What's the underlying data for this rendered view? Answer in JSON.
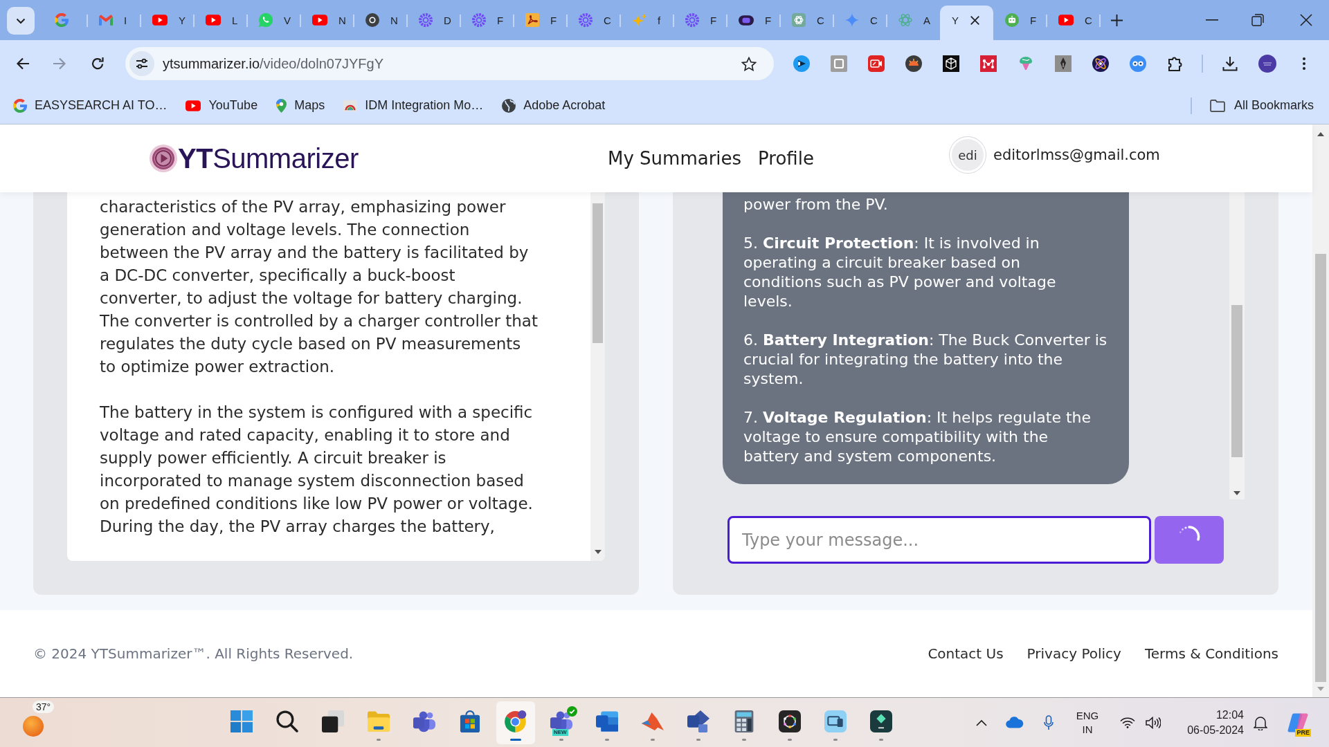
{
  "browser": {
    "tabs": [
      {
        "kind": "google",
        "pinned": true,
        "selected": false
      },
      {
        "kind": "mail",
        "title": "I",
        "pinned": false,
        "selected": false
      },
      {
        "kind": "video",
        "title": "Y",
        "pinned": false,
        "selected": false
      },
      {
        "kind": "video",
        "title": "L",
        "pinned": false,
        "selected": false
      },
      {
        "kind": "chat",
        "title": "V",
        "pinned": false,
        "selected": false
      },
      {
        "kind": "video",
        "title": "N",
        "pinned": false,
        "selected": false
      },
      {
        "kind": "ring",
        "title": "N",
        "pinned": false,
        "selected": false
      },
      {
        "kind": "gear",
        "title": "D",
        "pinned": false,
        "selected": false
      },
      {
        "kind": "gear",
        "title": "F",
        "pinned": false,
        "selected": false
      },
      {
        "kind": "pdf",
        "title": "F",
        "pinned": false,
        "selected": false
      },
      {
        "kind": "gear",
        "title": "C",
        "pinned": false,
        "selected": false
      },
      {
        "kind": "sparkle",
        "title": "f",
        "pinned": false,
        "selected": false
      },
      {
        "kind": "gear",
        "title": "F",
        "pinned": false,
        "selected": false
      },
      {
        "kind": "mask",
        "title": "F",
        "pinned": false,
        "selected": false
      },
      {
        "kind": "knot",
        "title": "C",
        "pinned": false,
        "selected": false
      },
      {
        "kind": "star",
        "title": "C",
        "pinned": false,
        "selected": false
      },
      {
        "kind": "mesh",
        "title": "A",
        "pinned": false,
        "selected": false
      },
      {
        "kind": "none",
        "title": "Y",
        "pinned": false,
        "selected": true
      },
      {
        "kind": "robot",
        "title": "F",
        "pinned": false,
        "selected": false
      },
      {
        "kind": "video",
        "title": "C",
        "pinned": false,
        "selected": false
      }
    ],
    "address": {
      "host": "ytsummarizer.io",
      "path": "/video/doln07JYFgY"
    },
    "bookmarks": [
      {
        "kind": "google",
        "label": "EASYSEARCH AI TO…"
      },
      {
        "kind": "video",
        "label": "YouTube"
      },
      {
        "kind": "pin",
        "label": "Maps"
      },
      {
        "kind": "arc",
        "label": "IDM Integration Mo…"
      },
      {
        "kind": "globe",
        "label": "Adobe Acrobat"
      }
    ],
    "all_bookmarks": "All Bookmarks"
  },
  "page": {
    "logo": "**YT**Summarizer",
    "nav": [
      "My Summaries",
      "Profile"
    ],
    "user": {
      "initials": "edi",
      "email": "editorlmss@gmail.com"
    },
    "summary": {
      "paragraphs": [
        "characteristics of the PV array, emphasizing power\ngeneration and voltage levels. The connection\nbetween the PV array and the battery is facilitated by\na DC-DC converter, specifically a buck-boost\nconverter, to adjust the voltage for battery charging.\nThe converter is controlled by a charger controller that\nregulates the duty cycle based on PV measurements\nto optimize power extraction.",
        "The battery in the system is configured with a specific\nvoltage and rated capacity, enabling it to store and\nsupply power efficiently. A circuit breaker is\nincorporated to manage system disconnection based\non predefined conditions like low PV power or voltage.\nDuring the day, the PV array charges the battery,"
      ]
    },
    "chat": {
      "messages": [
        {
          "kind": "bot",
          "paragraphs": [
            "power from the PV.",
            "5. **Circuit Protection**: It is involved in\noperating a circuit breaker based on\nconditions such as PV power and voltage\nlevels.",
            "6. **Battery Integration**: The Buck Converter is\ncrucial for integrating the battery into the\nsystem.",
            "7. **Voltage Regulation**: It helps regulate the\nvoltage to ensure compatibility with the\nbattery and system components."
          ]
        }
      ],
      "input": {
        "placeholder": "Type your message..."
      },
      "send": {
        "loading": true
      }
    },
    "footer": {
      "copyright": "© 2024 YTSummarizer™. All Rights Reserved.",
      "links": [
        "Contact Us",
        "Privacy Policy",
        "Terms & Conditions"
      ]
    }
  },
  "taskbar": {
    "weather": {
      "temperature": "37°"
    },
    "apps": [
      {
        "kind": "start",
        "open": false,
        "selected": false
      },
      {
        "kind": "search",
        "open": false,
        "selected": false
      },
      {
        "kind": "taskview",
        "open": false,
        "selected": false
      },
      {
        "kind": "folder",
        "open": true,
        "selected": false
      },
      {
        "kind": "teams",
        "open": false,
        "selected": false
      },
      {
        "kind": "store",
        "open": false,
        "selected": false
      },
      {
        "kind": "browser",
        "open": true,
        "selected": true
      },
      {
        "kind": "teams",
        "tag": "NEW",
        "open": true,
        "selected": false
      },
      {
        "kind": "word",
        "open": true,
        "selected": false
      },
      {
        "kind": "matlab",
        "open": true,
        "selected": false
      },
      {
        "kind": "visio",
        "open": true,
        "selected": false
      },
      {
        "kind": "calculator",
        "open": true,
        "selected": false
      },
      {
        "kind": "camera",
        "open": true,
        "selected": false
      },
      {
        "kind": "phone",
        "open": true,
        "selected": false
      },
      {
        "kind": "editor",
        "open": true,
        "selected": false
      }
    ],
    "tray": {
      "language": "ENG",
      "region": "IN",
      "time": "12:04",
      "date": "06-05-2024"
    },
    "copilot": {
      "tag": "PRE"
    }
  }
}
